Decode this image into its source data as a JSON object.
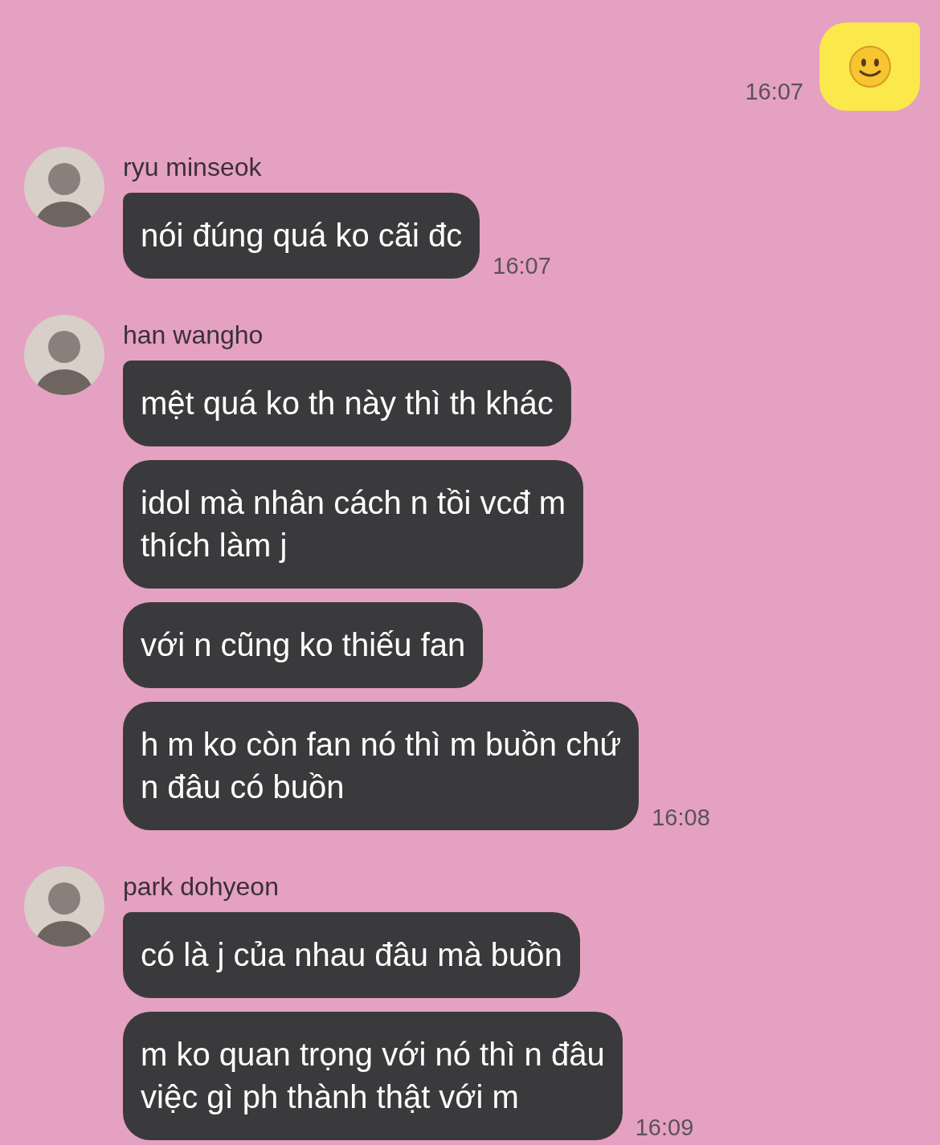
{
  "outgoing": [
    {
      "kind": "emoji",
      "time": "16:07"
    }
  ],
  "groups": [
    {
      "sender": "ryu minseok",
      "time": "16:07",
      "messages": [
        {
          "lines": [
            "nói đúng quá ko cãi đc"
          ]
        }
      ]
    },
    {
      "sender": "han wangho",
      "time": "16:08",
      "messages": [
        {
          "lines": [
            "mệt quá ko th này thì th khác"
          ]
        },
        {
          "lines": [
            "idol mà nhân cách n tồi vcđ m",
            "thích làm j"
          ]
        },
        {
          "lines": [
            "với n cũng ko thiếu fan"
          ]
        },
        {
          "lines": [
            "h m ko còn fan nó thì m buồn chứ",
            "n đâu có buồn"
          ]
        }
      ]
    },
    {
      "sender": "park dohyeon",
      "time": "16:09",
      "messages": [
        {
          "lines": [
            "có là j của nhau đâu mà buồn"
          ]
        },
        {
          "lines": [
            "m ko quan trọng với nó thì n đâu",
            "việc gì ph thành thật với m"
          ]
        }
      ]
    }
  ]
}
